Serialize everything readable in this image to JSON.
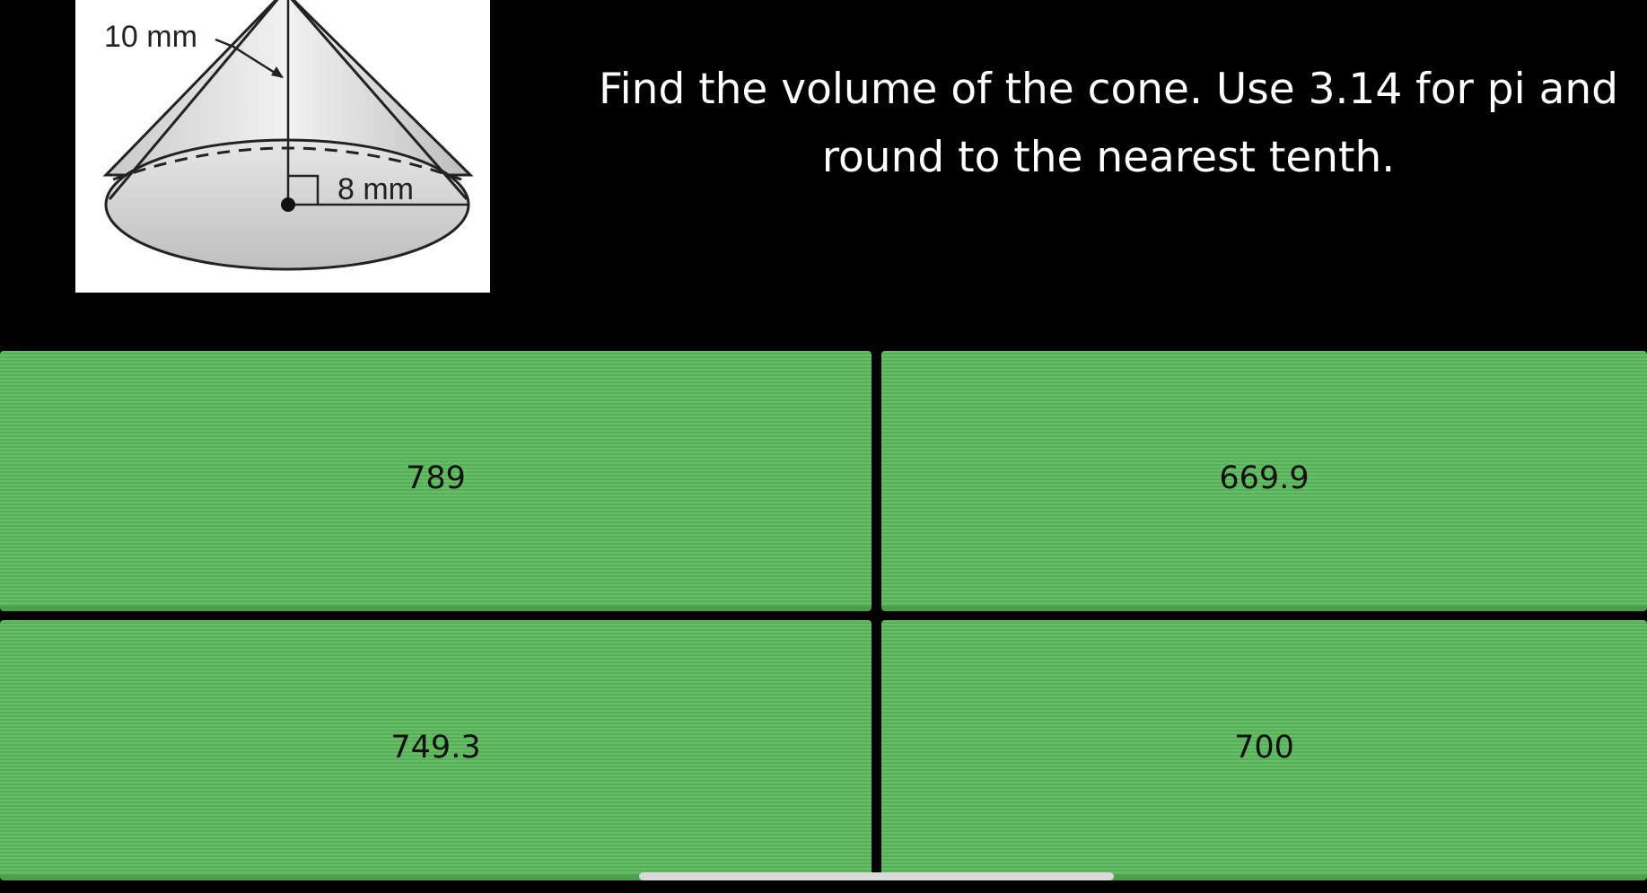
{
  "figure": {
    "slant_label": "10 mm",
    "radius_label": "8 mm"
  },
  "question": {
    "text": "Find the volume of the cone. Use 3.14 for pi and round to the nearest tenth."
  },
  "answers": [
    {
      "label": "789"
    },
    {
      "label": "669.9"
    },
    {
      "label": "749.3"
    },
    {
      "label": "700"
    }
  ],
  "colors": {
    "answer_bg": "#5cb85c",
    "background": "#000000"
  }
}
